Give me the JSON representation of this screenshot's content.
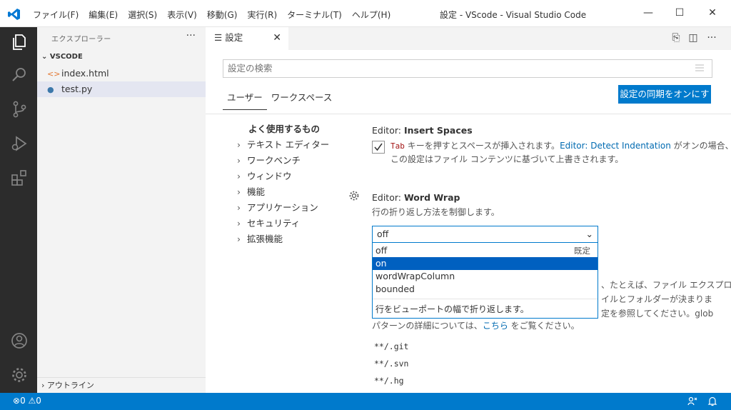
{
  "titlebar": {
    "menu": [
      "ファイル(F)",
      "編集(E)",
      "選択(S)",
      "表示(V)",
      "移動(G)",
      "実行(R)",
      "ターミナル(T)",
      "ヘルプ(H)"
    ],
    "window_title": "設定 - VScode - Visual Studio Code"
  },
  "sidebar": {
    "title": "エクスプローラー",
    "more": "···",
    "section": "VSCODE",
    "files": [
      "index.html",
      "test.py"
    ],
    "outline": "アウトライン"
  },
  "tab": {
    "label": "設定",
    "close": "✕"
  },
  "search": {
    "placeholder": "設定の検索"
  },
  "scopes": [
    "ユーザー",
    "ワークスペース"
  ],
  "sync_button": "設定の同期をオンにする",
  "toc": {
    "heading": "よく使用するもの",
    "items": [
      "テキスト エディター",
      "ワークベンチ",
      "ウィンドウ",
      "機能",
      "アプリケーション",
      "セキュリティ",
      "拡張機能"
    ]
  },
  "insert_spaces": {
    "prefix": "Editor: ",
    "name": "Insert Spaces",
    "code": "Tab",
    "desc1": " キーを押すとスペースが挿入されます。",
    "link": "Editor: Detect Indentation",
    "desc2": " がオンの場合、",
    "desc3": "この設定はファイル コンテンツに基づいて上書きされます。",
    "checked": true
  },
  "word_wrap": {
    "prefix": "Editor: ",
    "name": "Word Wrap",
    "desc": "行の折り返し方法を制御します。",
    "value": "off",
    "options": [
      "off",
      "on",
      "wordWrapColumn",
      "bounded"
    ],
    "default_label": "既定",
    "highlighted": "on",
    "option_desc": "行をビューポートの幅で折り返します。"
  },
  "files_exclude": {
    "frag1": "、たとえば、ファイル エクスプロ",
    "frag2": "イルとフォルダーが決まりま",
    "frag3": "定を参照してください。glob",
    "line4_a": "パターンの詳細については、",
    "line4_link": "こちら",
    "line4_b": " をご覧ください。",
    "patterns": [
      "**/.git",
      "**/.svn",
      "**/.hg"
    ]
  },
  "status": {
    "errors": "0",
    "warnings": "0"
  }
}
